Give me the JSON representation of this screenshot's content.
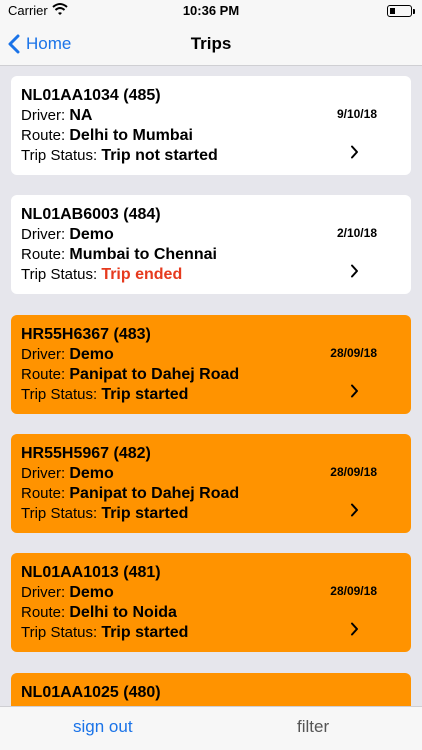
{
  "status_bar": {
    "carrier": "Carrier",
    "time": "10:36 PM"
  },
  "nav": {
    "back_label": "Home",
    "title": "Trips"
  },
  "labels": {
    "driver": "Driver: ",
    "route": "Route: ",
    "trip_status": "Trip Status: "
  },
  "trips": [
    {
      "vehicle": "NL01AA1034 (485)",
      "driver": "NA",
      "route": "Delhi to Mumbai",
      "status": "Trip not started",
      "date": "9/10/18",
      "style": "white"
    },
    {
      "vehicle": "NL01AB6003 (484)",
      "driver": "Demo",
      "route": "Mumbai to Chennai",
      "status": "Trip ended",
      "date": "2/10/18",
      "style": "white"
    },
    {
      "vehicle": "HR55H6367 (483)",
      "driver": "Demo",
      "route": "Panipat to Dahej Road",
      "status": "Trip started",
      "date": "28/09/18",
      "style": "orange"
    },
    {
      "vehicle": "HR55H5967 (482)",
      "driver": "Demo",
      "route": "Panipat to Dahej Road",
      "status": "Trip started",
      "date": "28/09/18",
      "style": "orange"
    },
    {
      "vehicle": "NL01AA1013 (481)",
      "driver": "Demo",
      "route": "Delhi to Noida",
      "status": "Trip started",
      "date": "28/09/18",
      "style": "orange"
    },
    {
      "vehicle": "NL01AA1025 (480)",
      "driver": "",
      "route": "",
      "status": "",
      "date": "",
      "style": "orange"
    }
  ],
  "colors": {
    "accent": "#1a73e8",
    "active_trip": "#ff9300",
    "ended_status": "#e63a1e"
  },
  "bottom_bar": {
    "sign_out": "sign out",
    "filter": "filter"
  }
}
